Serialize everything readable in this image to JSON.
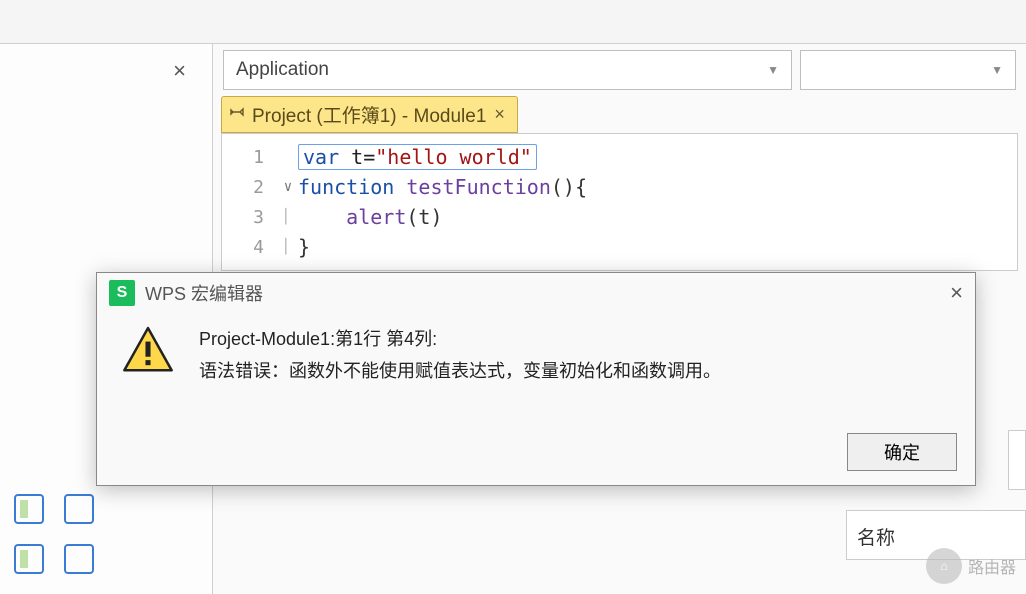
{
  "dropdown": {
    "selected": "Application"
  },
  "tab": {
    "label": "Project (工作簿1) - Module1"
  },
  "code": {
    "lines": [
      {
        "n": "1",
        "html_parts": [
          "var",
          " t=",
          "\"hello world\""
        ]
      },
      {
        "n": "2",
        "html_parts": [
          "function",
          " ",
          "testFunction",
          "(){"
        ]
      },
      {
        "n": "3",
        "html_parts": [
          "    ",
          "alert",
          "(t)"
        ]
      },
      {
        "n": "4",
        "html_parts": [
          "}"
        ]
      }
    ]
  },
  "dialog": {
    "app_letter": "S",
    "title": "WPS 宏编辑器",
    "message_line1": "Project-Module1:第1行 第4列:",
    "message_line2": "语法错误：函数外不能使用赋值表达式，变量初始化和函数调用。",
    "ok": "确定"
  },
  "right_panel": {
    "label": "名称"
  },
  "watermark": {
    "text": "路由器"
  }
}
